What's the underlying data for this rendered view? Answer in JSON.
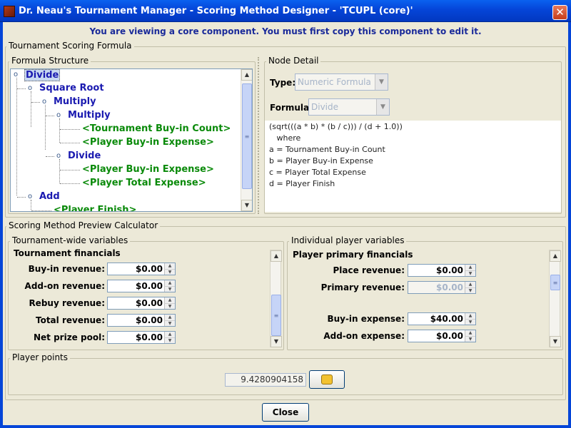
{
  "window": {
    "title": "Dr. Neau's Tournament Manager - Scoring Method Designer - 'TCUPL (core)'",
    "close_glyph": "✕"
  },
  "notice": "You are viewing a core component.  You must first copy this component to edit it.",
  "formula_section": {
    "label": "Tournament Scoring Formula",
    "structure_label": "Formula Structure",
    "tree": [
      {
        "label": "Divide",
        "kind": "operator",
        "selected": true
      },
      {
        "label": "Square Root",
        "kind": "operator"
      },
      {
        "label": "Multiply",
        "kind": "operator"
      },
      {
        "label": "Multiply",
        "kind": "operator"
      },
      {
        "label": "<Tournament Buy-in Count>",
        "kind": "variable"
      },
      {
        "label": "<Player Buy-in Expense>",
        "kind": "variable"
      },
      {
        "label": "Divide",
        "kind": "operator"
      },
      {
        "label": "<Player Buy-in Expense>",
        "kind": "variable"
      },
      {
        "label": "<Player Total Expense>",
        "kind": "variable"
      },
      {
        "label": "Add",
        "kind": "operator"
      },
      {
        "label": "<Player Finish>",
        "kind": "variable"
      }
    ],
    "node_detail": {
      "label": "Node Detail",
      "type_label": "Type:",
      "type_value": "Numeric Formula",
      "formula_label": "Formula:",
      "formula_value": "Divide",
      "expression_lines": [
        "(sqrt(((a * b) * (b / c))) / (d + 1.0))",
        "",
        "   where",
        "",
        "a = Tournament Buy-in Count",
        "b = Player Buy-in Expense",
        "c = Player Total Expense",
        "d = Player Finish"
      ]
    }
  },
  "preview": {
    "label": "Scoring Method Preview Calculator",
    "tournament": {
      "label": "Tournament-wide variables",
      "sublabel": "Tournament financials",
      "fields": [
        {
          "label": "Buy-in revenue:",
          "value": "$0.00"
        },
        {
          "label": "Add-on revenue:",
          "value": "$0.00"
        },
        {
          "label": "Rebuy revenue:",
          "value": "$0.00"
        },
        {
          "label": "Total revenue:",
          "value": "$0.00"
        },
        {
          "label": "Net prize pool:",
          "value": "$0.00"
        }
      ]
    },
    "player": {
      "label": "Individual player variables",
      "sublabel": "Player primary financials",
      "fields": [
        {
          "label": "Place revenue:",
          "value": "$0.00",
          "disabled": false
        },
        {
          "label": "Primary revenue:",
          "value": "$0.00",
          "disabled": true
        },
        {
          "label": "Buy-in expense:",
          "value": "$40.00",
          "disabled": false
        },
        {
          "label": "Add-on expense:",
          "value": "$0.00",
          "disabled": false
        }
      ]
    },
    "points": {
      "label": "Player points",
      "value": "9.4280904158",
      "calc_icon": "calculate-icon"
    }
  },
  "buttons": {
    "close": "Close"
  }
}
